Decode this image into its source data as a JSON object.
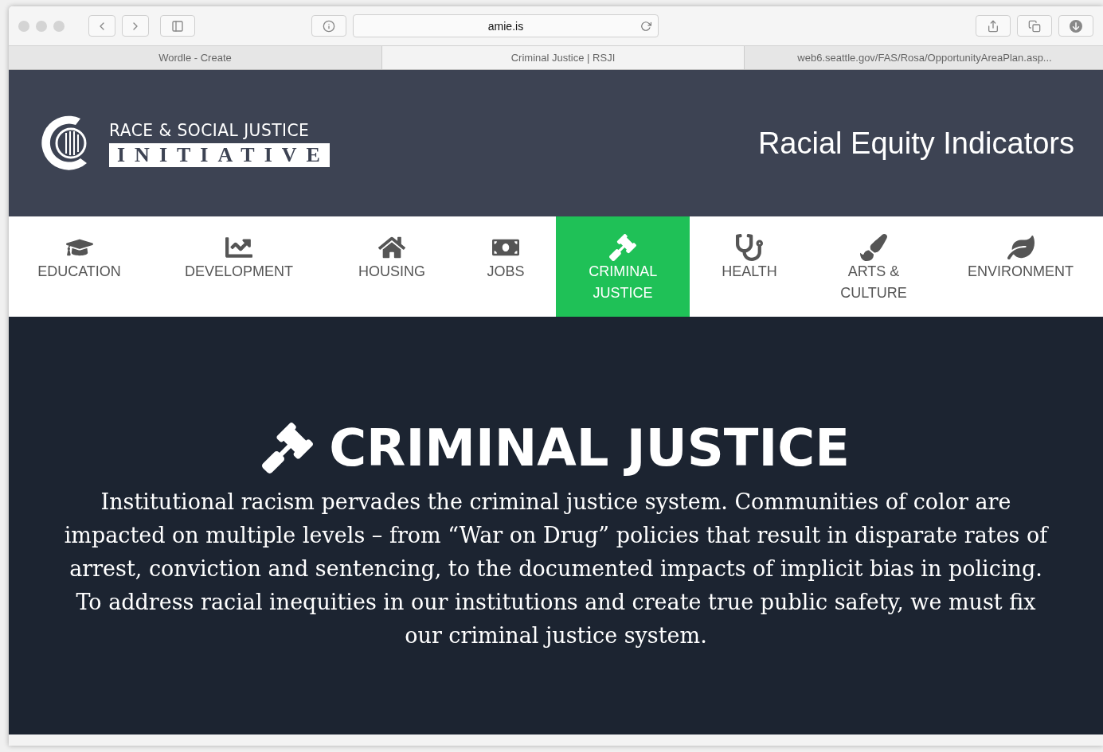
{
  "browser": {
    "address": "amie.is",
    "tabs": [
      {
        "label": "Wordle - Create",
        "selected": false
      },
      {
        "label": "Criminal Justice | RSJI",
        "selected": true
      },
      {
        "label": "web6.seattle.gov/FAS/Rosa/OpportunityAreaPlan.asp...",
        "selected": false
      }
    ]
  },
  "header": {
    "logo_line_1": "RACE & SOCIAL JUSTICE",
    "logo_line_2": "INITIATIVE",
    "title": "Racial Equity Indicators"
  },
  "nav": [
    {
      "kind": "education",
      "label": "EDUCATION",
      "selected": false
    },
    {
      "kind": "development",
      "label": "DEVELOPMENT",
      "selected": false
    },
    {
      "kind": "housing",
      "label": "HOUSING",
      "selected": false
    },
    {
      "kind": "jobs",
      "label": "JOBS",
      "selected": false
    },
    {
      "kind": "justice",
      "label": "CRIMINAL JUSTICE",
      "selected": true
    },
    {
      "kind": "health",
      "label": "HEALTH",
      "selected": false
    },
    {
      "kind": "arts",
      "label": "ARTS & CULTURE",
      "selected": false
    },
    {
      "kind": "environment",
      "label": "ENVIRONMENT",
      "selected": false
    }
  ],
  "hero": {
    "kind": "justice",
    "title": "CRIMINAL JUSTICE",
    "text": "Institutional racism pervades the criminal justice system. Communities of color are impacted on multiple levels – from “War on Drug” policies that result in disparate rates of arrest, conviction and sentencing, to the documented impacts of implicit bias in policing. To address racial inequities in our institutions and create true public safety, we must fix our criminal justice system."
  }
}
